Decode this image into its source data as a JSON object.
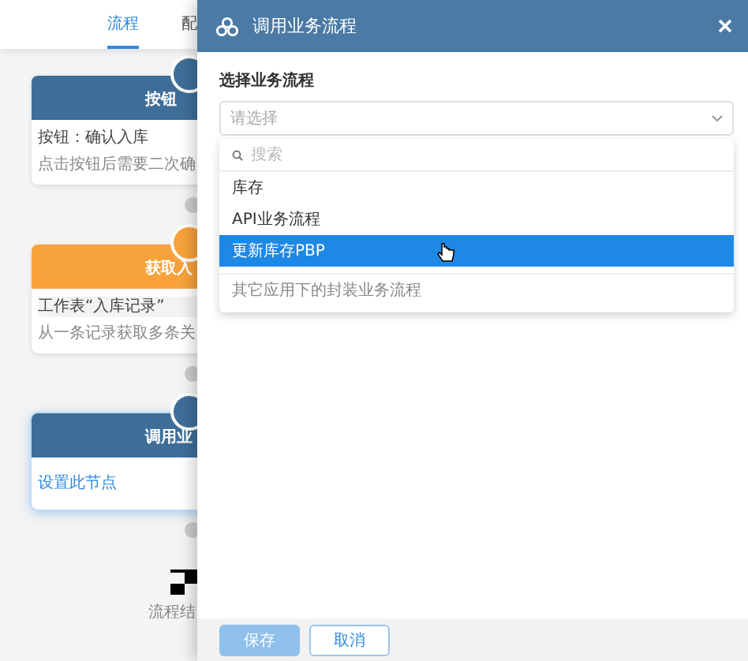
{
  "background": {
    "tabs": [
      {
        "label": "流程",
        "selected": true
      },
      {
        "label": "配",
        "selected": false
      }
    ],
    "nodes": [
      {
        "kind": "button",
        "title": "按钮",
        "selected": false,
        "lines": [
          "按钮：确认入库",
          "点击按钮后需要二次确"
        ]
      },
      {
        "kind": "fetch",
        "title": "获取入",
        "selected": false,
        "lines": [
          "工作表“入库记录”",
          "从一条记录获取多条关"
        ]
      },
      {
        "kind": "subprocess",
        "title": "调用业",
        "selected": true,
        "link": "设置此节点"
      }
    ],
    "end_label": "流程结"
  },
  "dialog": {
    "title": "调用业务流程",
    "field_label": "选择业务流程",
    "select": {
      "placeholder": "请选择"
    },
    "dropdown": {
      "search_placeholder": "搜索",
      "options": [
        {
          "label": "库存",
          "selected": false,
          "disabled": false
        },
        {
          "label": "API业务流程",
          "selected": false,
          "disabled": false
        },
        {
          "label": "更新库存PBP",
          "selected": true,
          "disabled": false
        },
        {
          "label": "其它应用下的封装业务流程",
          "selected": false,
          "disabled": true
        }
      ]
    },
    "buttons": [
      {
        "label": "保存",
        "kind": "primary",
        "disabled": true
      },
      {
        "label": "取消",
        "kind": "secondary",
        "disabled": false
      }
    ]
  }
}
